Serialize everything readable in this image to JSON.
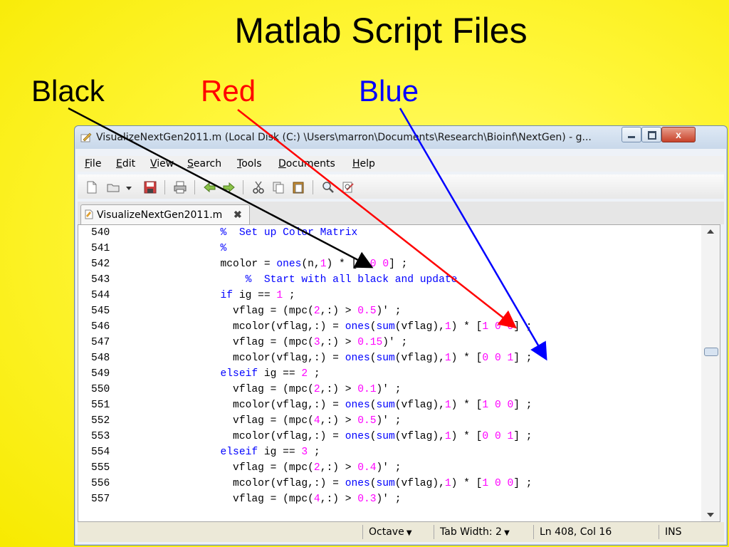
{
  "slide": {
    "title": "Matlab Script Files",
    "labels": {
      "black": {
        "text": "Black",
        "color": "#000000"
      },
      "red": {
        "text": "Red",
        "color": "#ff0000"
      },
      "blue": {
        "text": "Blue",
        "color": "#0000ff"
      }
    }
  },
  "window": {
    "title": "VisualizeNextGen2011.m (Local Disk (C:) \\Users\\marron\\Documents\\Research\\Bioinf\\NextGen) - g...",
    "controls": {
      "close_label": "x"
    }
  },
  "menu": {
    "items": [
      "File",
      "Edit",
      "View",
      "Search",
      "Tools",
      "Documents",
      "Help"
    ]
  },
  "toolbar": {
    "icons": [
      "new-file-icon",
      "open-folder-icon",
      "dropdown-arrow-icon",
      "save-icon",
      "print-icon",
      "undo-icon",
      "redo-icon",
      "cut-icon",
      "copy-icon",
      "paste-icon",
      "find-icon",
      "find-replace-icon"
    ]
  },
  "tab": {
    "label": "VisualizeNextGen2011.m",
    "close_glyph": "✖"
  },
  "editor": {
    "lines": [
      {
        "num": "540",
        "code": "      %  Set up Color Matrix"
      },
      {
        "num": "541",
        "code": "      %"
      },
      {
        "num": "542",
        "code": "      mcolor = ones(n,1) * [0 0 0] ;"
      },
      {
        "num": "543",
        "code": "          %  Start with all black and update"
      },
      {
        "num": "544",
        "code": "      if ig == 1 ;"
      },
      {
        "num": "545",
        "code": "        vflag = (mpc(2,:) > 0.5)' ;"
      },
      {
        "num": "546",
        "code": "        mcolor(vflag,:) = ones(sum(vflag),1) * [1 0 0] ;"
      },
      {
        "num": "547",
        "code": "        vflag = (mpc(3,:) > 0.15)' ;"
      },
      {
        "num": "548",
        "code": "        mcolor(vflag,:) = ones(sum(vflag),1) * [0 0 1] ;"
      },
      {
        "num": "549",
        "code": "      elseif ig == 2 ;"
      },
      {
        "num": "550",
        "code": "        vflag = (mpc(2,:) > 0.1)' ;"
      },
      {
        "num": "551",
        "code": "        mcolor(vflag,:) = ones(sum(vflag),1) * [1 0 0] ;"
      },
      {
        "num": "552",
        "code": "        vflag = (mpc(4,:) > 0.5)' ;"
      },
      {
        "num": "553",
        "code": "        mcolor(vflag,:) = ones(sum(vflag),1) * [0 0 1] ;"
      },
      {
        "num": "554",
        "code": "      elseif ig == 3 ;"
      },
      {
        "num": "555",
        "code": "        vflag = (mpc(2,:) > 0.4)' ;"
      },
      {
        "num": "556",
        "code": "        mcolor(vflag,:) = ones(sum(vflag),1) * [1 0 0] ;"
      },
      {
        "num": "557",
        "code": "        vflag = (mpc(4,:) > 0.3)' ;"
      }
    ],
    "syntax_colors": {
      "comment": "#0000ff",
      "keyword": "#0000ff",
      "function": "#0000ff",
      "number": "#ff00ff",
      "text": "#000000"
    }
  },
  "status": {
    "language": "Octave",
    "tab_width": "Tab Width:  2",
    "position": "Ln 408, Col 16",
    "mode": "INS"
  }
}
